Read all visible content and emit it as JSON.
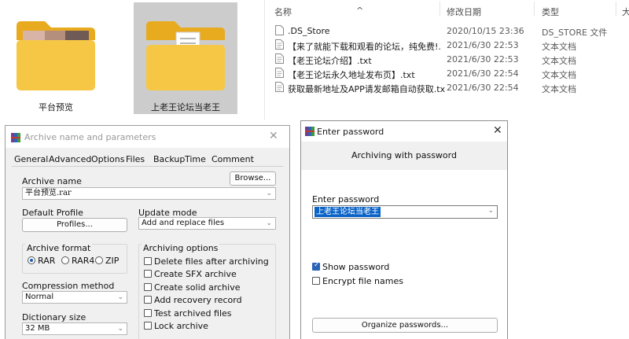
{
  "explorer_icons": {
    "folders": [
      {
        "name": "平台预览",
        "selected": false,
        "thumbnail": "preview-image-folder-icon"
      },
      {
        "name": "上老王论坛当老王",
        "selected": true,
        "thumbnail": "document-folder-icon"
      }
    ]
  },
  "explorer_details": {
    "columns": [
      "名称",
      "修改日期",
      "类型",
      "大"
    ],
    "files": [
      {
        "name": ".DS_Store",
        "date": "2020/10/15 23:36",
        "type": "DS_STORE 文件"
      },
      {
        "name": "【来了就能下载和观看的论坛，纯免费!...",
        "date": "2021/6/30 22:53",
        "type": "文本文档"
      },
      {
        "name": "【老王论坛介绍】.txt",
        "date": "2021/6/30 22:53",
        "type": "文本文档"
      },
      {
        "name": "【老王论坛永久地址发布页】.txt",
        "date": "2021/6/30 22:54",
        "type": "文本文档"
      },
      {
        "name": "获取最新地址及APP请发邮箱自动获取.txt",
        "date": "2021/6/30 22:54",
        "type": "文本文档"
      }
    ]
  },
  "archive_dialog": {
    "title": "Archive name and parameters",
    "tabs": [
      "General",
      "Advanced",
      "Options",
      "Files",
      "Backup",
      "Time",
      "Comment"
    ],
    "archive_name_label": "Archive name",
    "browse_label": "Browse...",
    "archive_name_value": "平台预览.rar",
    "default_profile_label": "Default Profile",
    "profiles_label": "Profiles...",
    "update_mode_label": "Update mode",
    "update_mode_value": "Add and replace files",
    "archive_format_label": "Archive format",
    "formats": [
      {
        "label": "RAR",
        "selected": true
      },
      {
        "label": "RAR4",
        "selected": false
      },
      {
        "label": "ZIP",
        "selected": false
      }
    ],
    "archiving_options_label": "Archiving options",
    "options": [
      {
        "label": "Delete files after archiving",
        "checked": false
      },
      {
        "label": "Create SFX archive",
        "checked": false
      },
      {
        "label": "Create solid archive",
        "checked": false
      },
      {
        "label": "Add recovery record",
        "checked": false
      },
      {
        "label": "Test archived files",
        "checked": false
      },
      {
        "label": "Lock archive",
        "checked": false
      }
    ],
    "compression_method_label": "Compression method",
    "compression_method_value": "Normal",
    "dictionary_size_label": "Dictionary size",
    "dictionary_size_value": "32 MB"
  },
  "password_dialog": {
    "title": "Enter password",
    "subtitle": "Archiving with password",
    "enter_password_label": "Enter password",
    "password_value": "上老王论坛当老王",
    "show_password_label": "Show password",
    "show_password_checked": true,
    "encrypt_names_label": "Encrypt file names",
    "encrypt_names_checked": false,
    "organize_label": "Organize passwords..."
  },
  "colors": {
    "folder_yellow": "#f6c744",
    "selection_blue": "#0a64c8",
    "checkbox_blue": "#2a64b6"
  }
}
